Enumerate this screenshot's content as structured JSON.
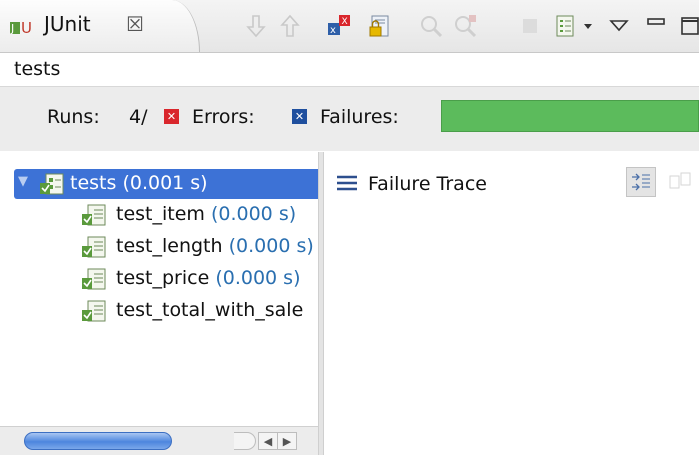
{
  "view_tab": {
    "title": "JUnit",
    "close_label": "☒"
  },
  "toolbar": {
    "items": [
      {
        "name": "next-failure-icon"
      },
      {
        "name": "previous-failure-icon"
      },
      {
        "name": "show-failures-only-icon"
      },
      {
        "name": "scroll-lock-icon"
      },
      {
        "name": "rerun-test-icon"
      },
      {
        "name": "rerun-failed-first-icon"
      },
      {
        "name": "stop-icon"
      },
      {
        "name": "test-run-history-icon"
      },
      {
        "name": "view-menu-icon"
      },
      {
        "name": "minimize-icon"
      },
      {
        "name": "maximize-icon"
      }
    ]
  },
  "status": {
    "text": "tests"
  },
  "counters": {
    "runs_label": "Runs:",
    "runs_value": "4/",
    "errors_label": "Errors:",
    "failures_label": "Failures:",
    "progress_fraction": 1.0,
    "progress_color": "#5cbb5c"
  },
  "tree": {
    "root": {
      "name": "tests",
      "time": "(0.001 s)"
    },
    "children": [
      {
        "name": "test_item",
        "time": "(0.000 s)"
      },
      {
        "name": "test_length",
        "time": "(0.000 s)"
      },
      {
        "name": "test_price",
        "time": "(0.000 s)"
      },
      {
        "name": "test_total_with_sale",
        "time": ""
      }
    ]
  },
  "failure_trace": {
    "title": "Failure Trace"
  },
  "colors": {
    "selection": "#3d72d6",
    "time_text": "#2a6fb0",
    "error_marker": "#d9262c",
    "failure_marker": "#1f4f9e"
  }
}
